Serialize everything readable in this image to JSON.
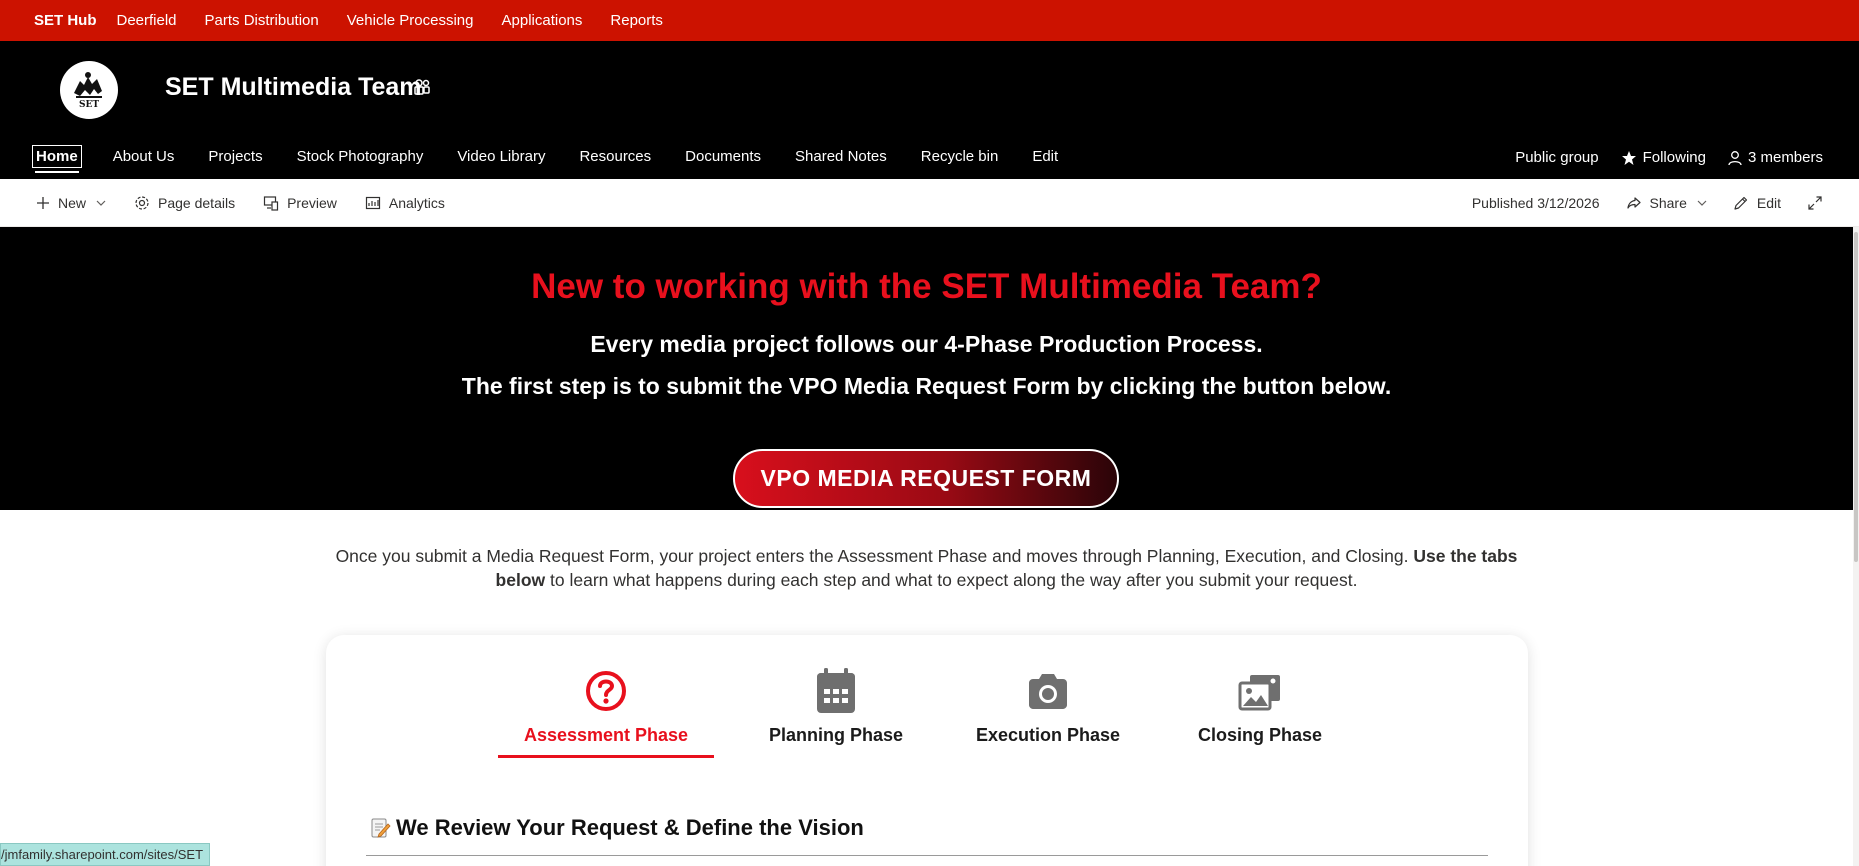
{
  "hub": {
    "title": "SET Hub",
    "links": [
      "Deerfield",
      "Parts Distribution",
      "Vehicle Processing",
      "Applications",
      "Reports"
    ]
  },
  "site": {
    "title": "SET Multimedia Team",
    "logo_text": "SET",
    "nav": [
      "Home",
      "About Us",
      "Projects",
      "Stock Photography",
      "Video Library",
      "Resources",
      "Documents",
      "Shared Notes",
      "Recycle bin",
      "Edit"
    ],
    "active_nav": "Home",
    "group_type": "Public group",
    "following": "Following",
    "members": "3 members"
  },
  "command_bar": {
    "new": "New",
    "page_details": "Page details",
    "preview": "Preview",
    "analytics": "Analytics",
    "published": "Published 3/12/2026",
    "share": "Share",
    "edit": "Edit"
  },
  "hero": {
    "title": "New to working with the SET Multimedia Team?",
    "line1": "Every media project follows our 4-Phase Production Process.",
    "line2": "The first step is to submit the VPO Media Request Form by clicking the button below.",
    "button": "VPO MEDIA REQUEST FORM"
  },
  "intro": {
    "text_before": "Once you submit a Media Request Form, your project enters the Assessment Phase and moves through Planning, Execution, and Closing. ",
    "bold": "Use the tabs below",
    "text_after": " to learn what happens during each step and what to expect along the way after you submit your request."
  },
  "phases": {
    "tabs": [
      {
        "label": "Assessment Phase",
        "icon": "question-circle-icon"
      },
      {
        "label": "Planning Phase",
        "icon": "calendar-icon"
      },
      {
        "label": "Execution Phase",
        "icon": "camera-icon"
      },
      {
        "label": "Closing Phase",
        "icon": "photo-gallery-icon"
      }
    ],
    "active": "Assessment Phase",
    "section_heading": "We Review Your Request & Define the Vision"
  },
  "status_bar": {
    "url": "/jmfamily.sharepoint.com/sites/SET"
  },
  "colors": {
    "hub_red": "#cc1200",
    "accent_red": "#e8101d",
    "header_black": "#000000"
  }
}
